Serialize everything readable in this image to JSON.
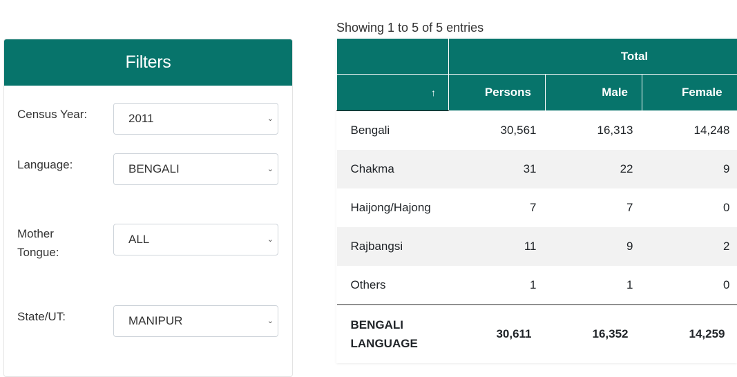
{
  "filters": {
    "title": "Filters",
    "census_year": {
      "label": "Census Year:",
      "value": "2011"
    },
    "language": {
      "label": "Language:",
      "value": "BENGALI"
    },
    "mother_tongue": {
      "label_line1": "Mother",
      "label_line2": "Tongue:",
      "value": "ALL"
    },
    "state": {
      "label": "State/UT:",
      "value": "MANIPUR"
    }
  },
  "table": {
    "info": "Showing 1 to 5 of 5 entries",
    "group_header": "Total",
    "sort_icon": "↑",
    "columns": [
      "Persons",
      "Male",
      "Female"
    ],
    "rows": [
      {
        "name": "Bengali",
        "persons": "30,561",
        "male": "16,313",
        "female": "14,248"
      },
      {
        "name": "Chakma",
        "persons": "31",
        "male": "22",
        "female": "9"
      },
      {
        "name": "Haijong/Hajong",
        "persons": "7",
        "male": "7",
        "female": "0"
      },
      {
        "name": "Rajbangsi",
        "persons": "11",
        "male": "9",
        "female": "2"
      },
      {
        "name": "Others",
        "persons": "1",
        "male": "1",
        "female": "0"
      }
    ],
    "footer": {
      "name_line1": "BENGALI",
      "name_line2": "LANGUAGE",
      "persons": "30,611",
      "male": "16,352",
      "female": "14,259"
    }
  },
  "colors": {
    "accent": "#07746b",
    "alt_row": "#f2f2f2"
  }
}
